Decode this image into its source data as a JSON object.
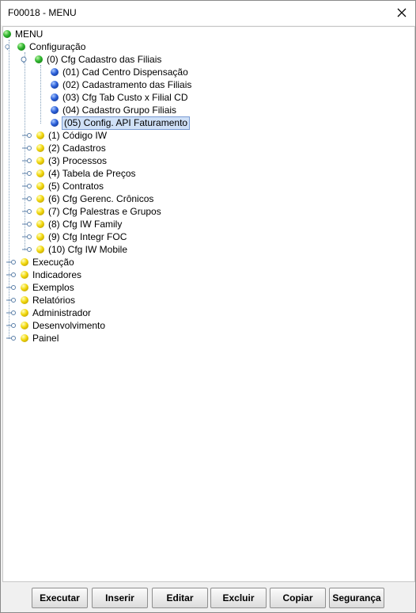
{
  "window": {
    "title": "F00018 - MENU"
  },
  "tree": {
    "root": "MENU",
    "configuracao": "Configuração",
    "cfg_cadastro_filiais": "(0) Cfg Cadastro das Filiais",
    "leaf01": "(01) Cad Centro Dispensação",
    "leaf02": "(02) Cadastramento das Filiais",
    "leaf03": "(03) Cfg Tab Custo x Filial CD",
    "leaf04": "(04) Cadastro Grupo Filiais",
    "leaf05": "(05) Config. API Faturamento",
    "cfg1": "(1) Código IW",
    "cfg2": "(2) Cadastros",
    "cfg3": "(3) Processos",
    "cfg4": "(4) Tabela de Preços",
    "cfg5": "(5) Contratos",
    "cfg6": "(6) Cfg Gerenc. Crônicos",
    "cfg7": "(7) Cfg Palestras e Grupos",
    "cfg8": "(8) Cfg IW Family",
    "cfg9": "(9) Cfg Integr FOC",
    "cfg10": "(10) Cfg IW Mobile",
    "execucao": "Execução",
    "indicadores": "Indicadores",
    "exemplos": "Exemplos",
    "relatorios": "Relatórios",
    "administrador": "Administrador",
    "desenvolvimento": "Desenvolvimento",
    "painel": "Painel",
    "selected": "(05) Config. API Faturamento"
  },
  "buttons": {
    "executar": "Executar",
    "inserir": "Inserir",
    "editar": "Editar",
    "excluir": "Excluir",
    "copiar": "Copiar",
    "seguranca": "Segurança"
  },
  "icons": {
    "close": "close-icon",
    "node_expanded": "expanded-handle-icon",
    "node_collapsed": "collapsed-handle-icon",
    "ball_green": "green-ball-icon",
    "ball_blue": "blue-ball-icon",
    "ball_yellow": "yellow-ball-icon"
  },
  "colors": {
    "selection_bg": "#cfe0f7",
    "selection_border": "#7a9cd3",
    "tree_line": "#7f9db9"
  }
}
